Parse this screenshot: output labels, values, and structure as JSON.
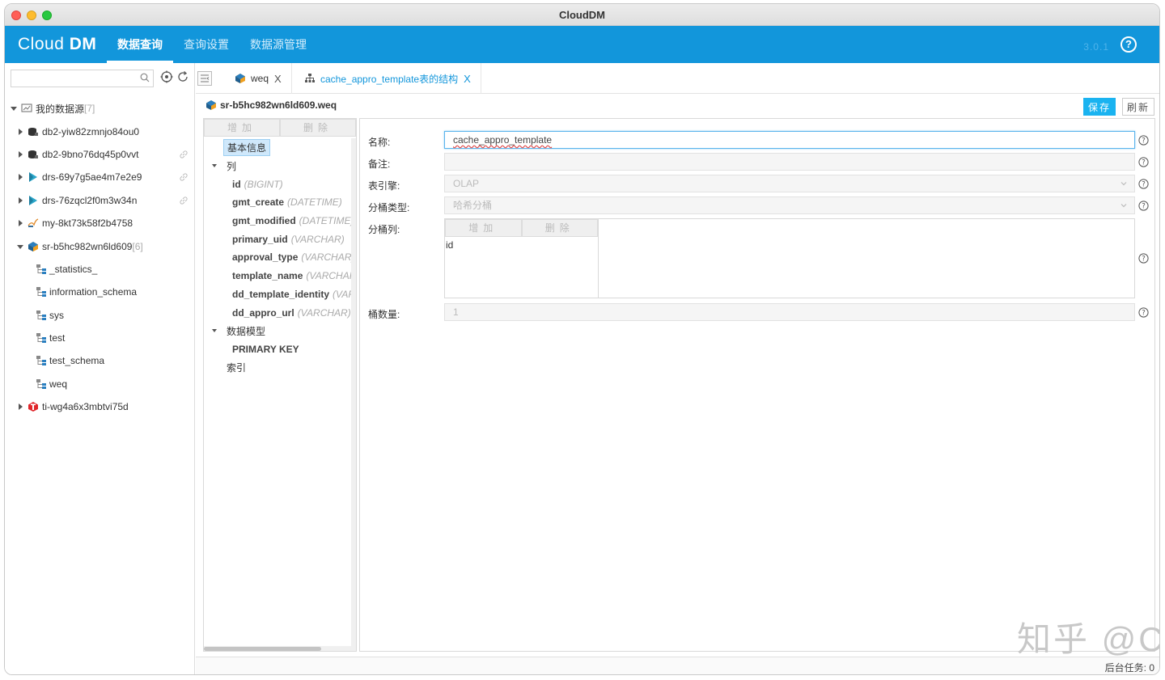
{
  "window": {
    "title": "CloudDM"
  },
  "app": {
    "logo_prefix": "Cloud ",
    "logo_suffix": "DM",
    "version": "3.0.1",
    "accent_color": "#1296db",
    "nav": [
      {
        "label": "数据查询",
        "active": true
      },
      {
        "label": "查询设置",
        "active": false
      },
      {
        "label": "数据源管理",
        "active": false
      }
    ]
  },
  "sidebar": {
    "search": {
      "value": "",
      "placeholder": ""
    },
    "root": {
      "label": "我的数据源",
      "count": "[7]"
    },
    "sources": [
      {
        "name": "db2-yiw82zmnjo84ou0",
        "icon": "db2-icon",
        "expanded": false,
        "link": false
      },
      {
        "name": "db2-9bno76dq45p0vvt",
        "icon": "db2-icon",
        "expanded": false,
        "link": true
      },
      {
        "name": "drs-69y7g5ae4m7e2e9",
        "icon": "drs-icon",
        "expanded": false,
        "link": true
      },
      {
        "name": "drs-76zqcl2f0m3w34n",
        "icon": "drs-icon",
        "expanded": false,
        "link": true
      },
      {
        "name": "my-8kt73k58f2b4758",
        "icon": "mysql-icon",
        "expanded": false,
        "link": false
      },
      {
        "name": "sr-b5hc982wn6ld609",
        "icon": "starrocks-icon",
        "expanded": true,
        "link": false,
        "count": "[6]"
      }
    ],
    "schemas": [
      "_statistics_",
      "information_schema",
      "sys",
      "test",
      "test_schema",
      "weq"
    ],
    "last_source": {
      "name": "ti-wg4a6x3mbtvi75d",
      "icon": "tidb-icon"
    }
  },
  "tabs": [
    {
      "label": "weq",
      "close": "X",
      "active": false
    },
    {
      "label": "cache_appro_template表的结构",
      "close": "X",
      "active": true
    }
  ],
  "path": {
    "label": "sr-b5hc982wn6ld609.weq"
  },
  "actions": {
    "save": "保存",
    "refresh": "刷新"
  },
  "structure": {
    "add": "增加",
    "delete": "删除",
    "basic_info": "基本信息",
    "columns_label": "列",
    "columns": [
      {
        "name": "id",
        "type": "(BIGINT)"
      },
      {
        "name": "gmt_create",
        "type": "(DATETIME)"
      },
      {
        "name": "gmt_modified",
        "type": "(DATETIME)"
      },
      {
        "name": "primary_uid",
        "type": "(VARCHAR)"
      },
      {
        "name": "approval_type",
        "type": "(VARCHAR)"
      },
      {
        "name": "template_name",
        "type": "(VARCHAR)"
      },
      {
        "name": "dd_template_identity",
        "type": "(VARCHAR)"
      },
      {
        "name": "dd_appro_url",
        "type": "(VARCHAR)"
      }
    ],
    "data_model_label": "数据模型",
    "data_model_items": [
      "PRIMARY KEY"
    ],
    "index_label": "索引"
  },
  "form": {
    "name_label": "名称:",
    "name_value": "cache_appro_template",
    "comment_label": "备注:",
    "comment_value": "",
    "engine_label": "表引擎:",
    "engine_value": "OLAP",
    "bucket_type_label": "分桶类型:",
    "bucket_type_value": "哈希分桶",
    "bucket_cols_label": "分桶列:",
    "bucket_add": "增加",
    "bucket_delete": "删除",
    "bucket_cols": [
      "id"
    ],
    "bucket_count_label": "桶数量:",
    "bucket_count_value": "1"
  },
  "watermark": "知乎 @ClouGence",
  "status": {
    "background_tasks": "后台任务: 0"
  }
}
